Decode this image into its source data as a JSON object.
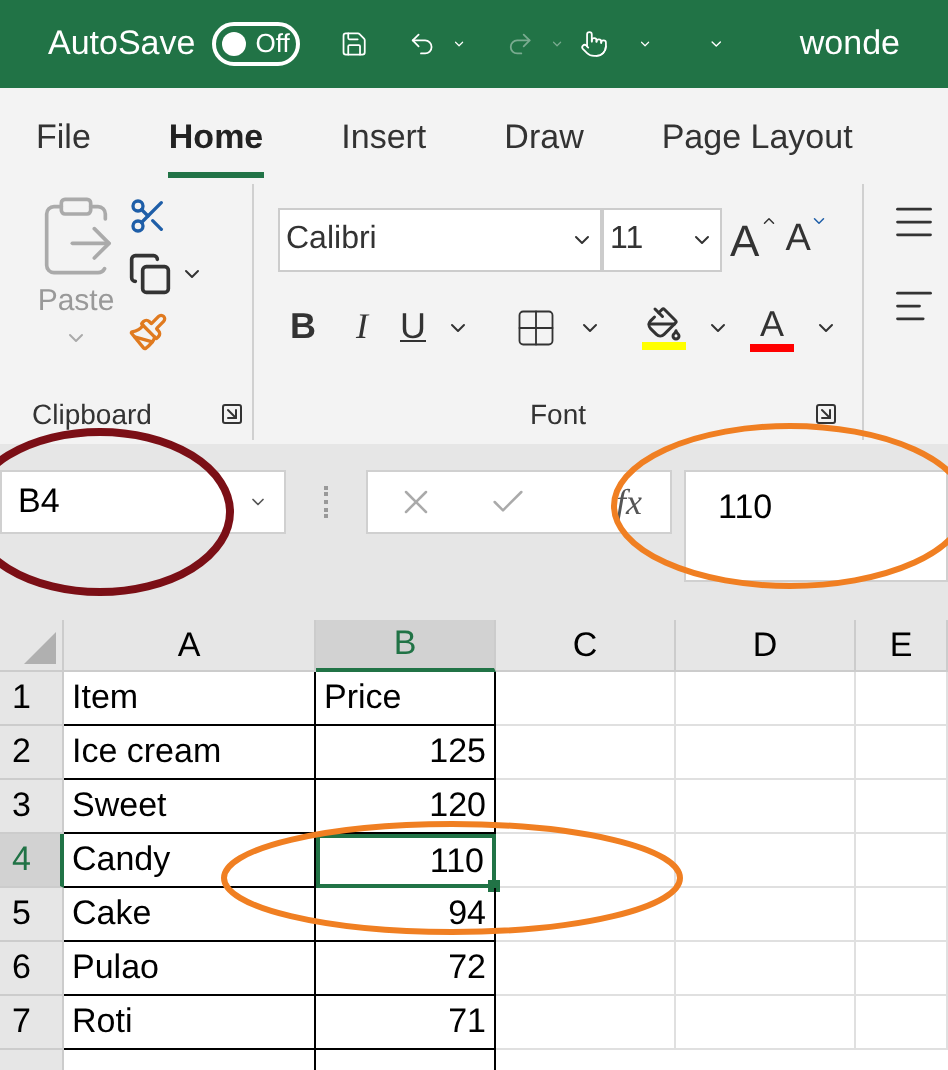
{
  "title_bar": {
    "autosave_label": "AutoSave",
    "autosave": {
      "label": "Off",
      "on": false
    },
    "document_title": "wonde"
  },
  "tabs": [
    {
      "label": "File",
      "selected": false
    },
    {
      "label": "Home",
      "selected": true
    },
    {
      "label": "Insert",
      "selected": false
    },
    {
      "label": "Draw",
      "selected": false
    },
    {
      "label": "Page Layout",
      "selected": false
    }
  ],
  "ribbon": {
    "paste_label": "Paste",
    "font_name": "Calibri",
    "font_size": "11",
    "grow_font": "A",
    "shrink_font": "A",
    "bold": "B",
    "italic": "I",
    "underline": "U",
    "font_color": "A",
    "groups": [
      "Clipboard",
      "Font"
    ]
  },
  "formula_bar": {
    "name_box": "B4",
    "fx": "fx",
    "formula": "110"
  },
  "sheet": {
    "columns": [
      {
        "label": "A",
        "selected": false
      },
      {
        "label": "B",
        "selected": true
      },
      {
        "label": "C",
        "selected": false
      },
      {
        "label": "D",
        "selected": false
      },
      {
        "label": "E",
        "selected": false
      }
    ],
    "rows": [
      {
        "header": "1",
        "selected": false,
        "cells": [
          {
            "text": "Item",
            "kind": "text",
            "selected": false
          },
          {
            "text": "Price",
            "kind": "text",
            "selected": false
          }
        ]
      },
      {
        "header": "2",
        "selected": false,
        "cells": [
          {
            "text": "Ice cream",
            "kind": "text",
            "selected": false
          },
          {
            "text": "125",
            "kind": "number",
            "selected": false
          }
        ]
      },
      {
        "header": "3",
        "selected": false,
        "cells": [
          {
            "text": "Sweet",
            "kind": "text",
            "selected": false
          },
          {
            "text": "120",
            "kind": "number",
            "selected": false
          }
        ]
      },
      {
        "header": "4",
        "selected": true,
        "cells": [
          {
            "text": "Candy",
            "kind": "text",
            "selected": false
          },
          {
            "text": "110",
            "kind": "number",
            "selected": true
          }
        ]
      },
      {
        "header": "5",
        "selected": false,
        "cells": [
          {
            "text": "Cake",
            "kind": "text",
            "selected": false
          },
          {
            "text": "94",
            "kind": "number",
            "selected": false
          }
        ]
      },
      {
        "header": "6",
        "selected": false,
        "cells": [
          {
            "text": "Pulao",
            "kind": "text",
            "selected": false
          },
          {
            "text": "72",
            "kind": "number",
            "selected": false
          }
        ]
      },
      {
        "header": "7",
        "selected": false,
        "cells": [
          {
            "text": "Roti",
            "kind": "text",
            "selected": false
          },
          {
            "text": "71",
            "kind": "number",
            "selected": false
          }
        ]
      }
    ]
  }
}
